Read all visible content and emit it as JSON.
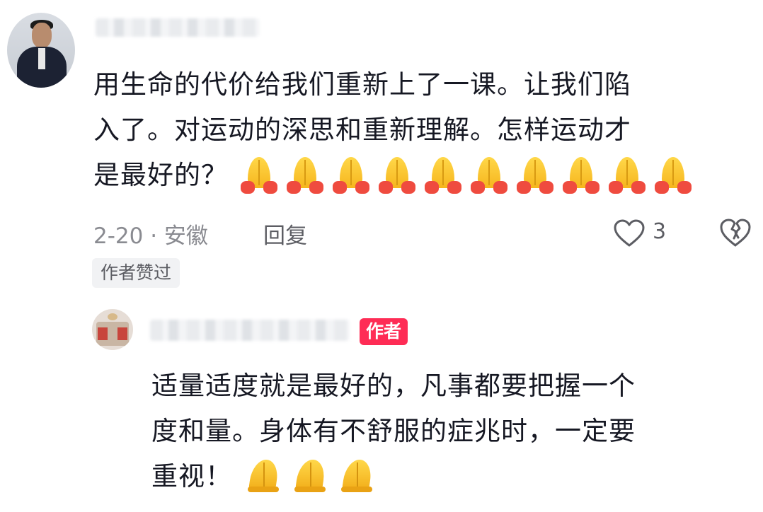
{
  "comment": {
    "text_line1": "用生命的代价给我们重新上了一课。让我们陷",
    "text_line2": "入了。对运动的深思和重新理解。怎样运动才",
    "text_line3": "是最好的？",
    "emoji": "folded-hands-emoji",
    "emoji_count": 10,
    "date_location": "2-20 · 安徽",
    "reply_label": "回复",
    "like_count": "3",
    "author_liked_badge": "作者赞过"
  },
  "reply": {
    "author_badge": "作者",
    "text_line1": "适量适度就是最好的，凡事都要把握一个",
    "text_line2": "度和量。身体有不舒服的症兆时，一定要",
    "text_line3": "重视！",
    "emoji": "folded-hands-emoji",
    "emoji_count": 3
  },
  "colors": {
    "accent_badge": "#fe2c55",
    "meta_text": "#8a8b91",
    "primary_text": "#161823"
  },
  "icons": {
    "like": "heart-outline-icon",
    "dislike": "broken-heart-outline-icon"
  }
}
